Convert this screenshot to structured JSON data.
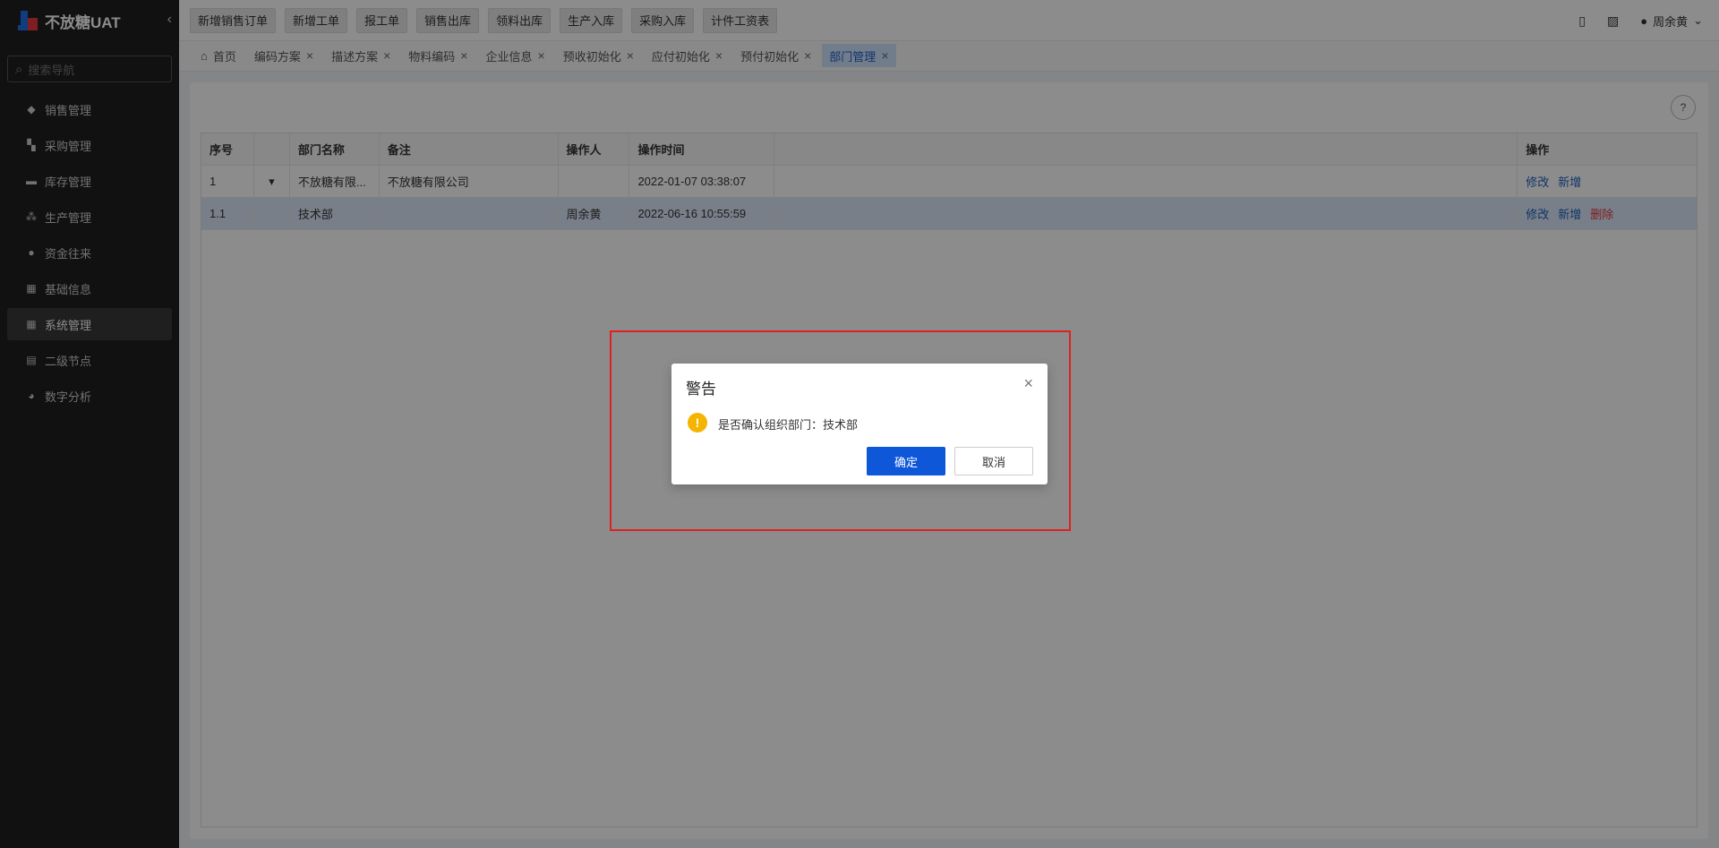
{
  "brand": {
    "name": "不放糖UAT",
    "collapse_icon": "chevron-left-icon"
  },
  "sidebar": {
    "search_placeholder": "搜索导航",
    "items": [
      {
        "label": "销售管理",
        "icon": "tag-icon"
      },
      {
        "label": "采购管理",
        "icon": "cart-icon"
      },
      {
        "label": "库存管理",
        "icon": "box-icon"
      },
      {
        "label": "生产管理",
        "icon": "gear-icon"
      },
      {
        "label": "资金往来",
        "icon": "coin-icon"
      },
      {
        "label": "基础信息",
        "icon": "grid-icon"
      },
      {
        "label": "系统管理",
        "icon": "apps-icon",
        "active": true
      },
      {
        "label": "二级节点",
        "icon": "doc-icon"
      },
      {
        "label": "数字分析",
        "icon": "pie-icon"
      }
    ]
  },
  "topbar": {
    "quick_buttons": [
      "新增销售订单",
      "新增工单",
      "报工单",
      "销售出库",
      "领料出库",
      "生产入库",
      "采购入库",
      "计件工资表"
    ],
    "user_name": "周余黄"
  },
  "tabs": [
    {
      "label": "首页",
      "home": true
    },
    {
      "label": "编码方案"
    },
    {
      "label": "描述方案"
    },
    {
      "label": "物料编码"
    },
    {
      "label": "企业信息"
    },
    {
      "label": "预收初始化"
    },
    {
      "label": "应付初始化"
    },
    {
      "label": "预付初始化"
    },
    {
      "label": "部门管理",
      "active": true
    }
  ],
  "table": {
    "headers": [
      "序号",
      "",
      "部门名称",
      "备注",
      "操作人",
      "操作时间",
      "",
      "操作"
    ],
    "rows": [
      {
        "index": "1",
        "name": "不放糖有限...",
        "remark": "不放糖有限公司",
        "operator": "",
        "time": "2022-01-07 03:38:07",
        "actions": [
          "修改",
          "新增"
        ]
      },
      {
        "index": "1.1",
        "name": "技术部",
        "remark": "",
        "operator": "周余黄",
        "time": "2022-06-16 10:55:59",
        "actions": [
          "修改",
          "新增",
          "删除"
        ]
      }
    ]
  },
  "dialog": {
    "title": "警告",
    "message": "是否确认组织部门：技术部",
    "ok_label": "确定",
    "cancel_label": "取消"
  },
  "colors": {
    "primary": "#0f57d9",
    "danger": "#e4393c",
    "warning": "#f5b400",
    "highlight_box": "#e02020"
  }
}
